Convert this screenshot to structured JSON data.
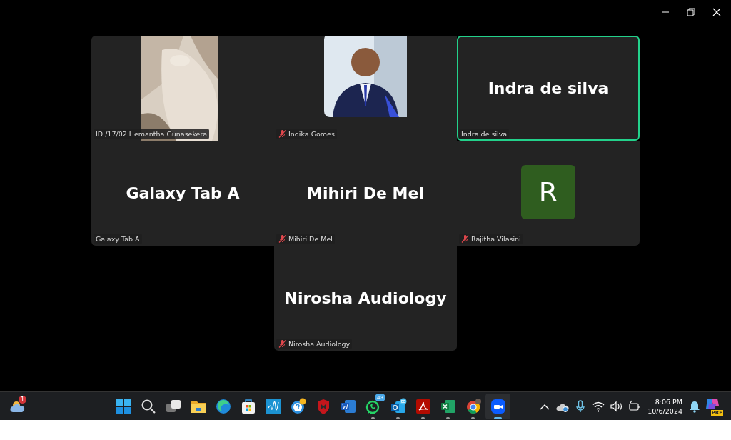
{
  "tiles": [
    {
      "kind": "video",
      "label": "ID /17/02 Hemantha  Gunasekera",
      "muted": false,
      "active": false
    },
    {
      "label": "Indika Gomes",
      "muted": true,
      "active": false
    },
    {
      "kind": "name",
      "display": "Indra de silva",
      "label": "Indra de silva",
      "muted": false,
      "active": true
    },
    {
      "kind": "name",
      "display": "Galaxy Tab A",
      "label": "Galaxy Tab A",
      "muted": false,
      "active": false
    },
    {
      "kind": "name",
      "display": "Mihiri De Mel",
      "label": "Mihiri De Mel",
      "muted": true,
      "active": false
    },
    {
      "kind": "avatar",
      "initial": "R",
      "color": "#2f5d1f",
      "label": "Rajitha Vilasini",
      "muted": true,
      "active": false
    },
    {
      "kind": "name",
      "display": "Nirosha Audiology",
      "label": "Nirosha Audiology",
      "muted": true,
      "active": false
    }
  ],
  "taskbar": {
    "weather": {
      "badge": "1"
    },
    "apps": [
      {
        "kind": "start",
        "running": false,
        "selected": false
      },
      {
        "kind": "search",
        "running": false,
        "selected": false
      },
      {
        "kind": "taskview",
        "running": false,
        "selected": false
      },
      {
        "kind": "folder",
        "running": false,
        "selected": false
      },
      {
        "kind": "edge",
        "running": false,
        "selected": false
      },
      {
        "kind": "store",
        "running": false,
        "selected": false
      },
      {
        "kind": "myhp",
        "running": false,
        "selected": false
      },
      {
        "kind": "help",
        "running": false,
        "selected": false
      },
      {
        "kind": "shield",
        "running": false,
        "selected": false
      },
      {
        "kind": "word",
        "running": false,
        "selected": false
      },
      {
        "kind": "chat",
        "badge": "43",
        "running": true,
        "selected": false
      },
      {
        "kind": "mail",
        "running": true,
        "selected": false
      },
      {
        "kind": "pdf",
        "running": true,
        "selected": false
      },
      {
        "kind": "excel",
        "running": true,
        "selected": false
      },
      {
        "kind": "browser",
        "running": true,
        "selected": false
      },
      {
        "kind": "zoom",
        "running": true,
        "selected": true
      }
    ],
    "time": "8:06 PM",
    "date": "10/6/2024",
    "copilot_badge": "PRE"
  }
}
